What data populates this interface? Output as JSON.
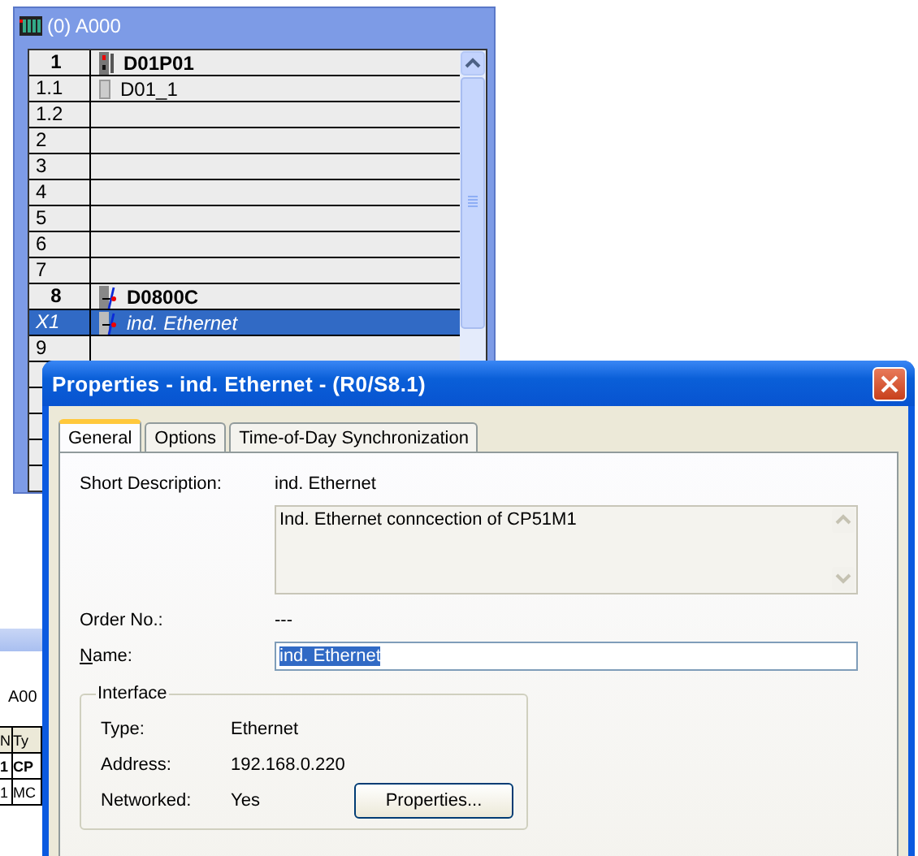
{
  "rack_window": {
    "title": "(0) A000",
    "rows": [
      {
        "slot": "1",
        "module": "D01P01",
        "kind": "cpu",
        "selected": false
      },
      {
        "slot": "1.1",
        "module": "D01_1",
        "kind": "card",
        "selected": false
      },
      {
        "slot": "1.2",
        "kind": "empty",
        "selected": false
      },
      {
        "slot": "2",
        "kind": "empty",
        "selected": false
      },
      {
        "slot": "3",
        "kind": "empty",
        "selected": false
      },
      {
        "slot": "4",
        "kind": "empty",
        "selected": false
      },
      {
        "slot": "5",
        "kind": "empty",
        "selected": false
      },
      {
        "slot": "6",
        "kind": "empty",
        "selected": false
      },
      {
        "slot": "7",
        "kind": "empty",
        "selected": false
      },
      {
        "slot": "8",
        "module": "D0800C",
        "kind": "cp",
        "selected": false
      },
      {
        "slot": "X1",
        "module": "ind. Ethernet",
        "kind": "port",
        "selected": true
      },
      {
        "slot": "9",
        "kind": "empty",
        "selected": false
      }
    ]
  },
  "back_window": {
    "label": "A00",
    "columns": [
      "N",
      "Ty"
    ],
    "rows": [
      {
        "cells": [
          "1",
          "CP"
        ],
        "bold": true
      },
      {
        "cells": [
          "1",
          "MC"
        ],
        "bold": false
      }
    ]
  },
  "dialog": {
    "title": "Properties - ind. Ethernet - (R0/S8.1)",
    "tabs": [
      {
        "label": "General",
        "selected": true
      },
      {
        "label": "Options",
        "selected": false
      },
      {
        "label": "Time-of-Day Synchronization",
        "selected": false
      }
    ],
    "short_description": {
      "label": "Short Description:",
      "value": "ind. Ethernet"
    },
    "comment": "Ind. Ethernet conncection of CP51M1",
    "order_no": {
      "label": "Order No.:",
      "value": "---"
    },
    "name": {
      "label": "Name:",
      "value": "ind. Ethernet"
    },
    "interface": {
      "title": "Interface",
      "rows": [
        {
          "label": "Type:",
          "value": "Ethernet"
        },
        {
          "label": "Address:",
          "value": "192.168.0.220"
        },
        {
          "label": "Networked:",
          "value": "Yes"
        }
      ],
      "button": "Properties..."
    }
  }
}
